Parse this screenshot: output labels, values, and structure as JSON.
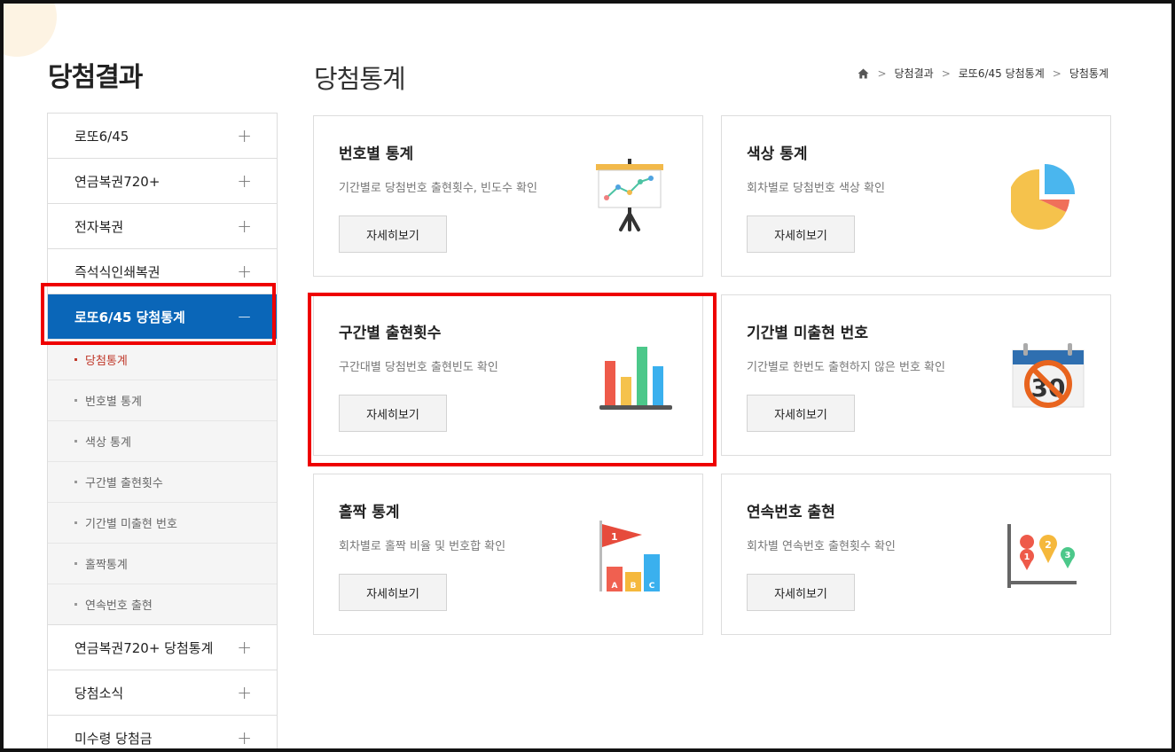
{
  "sidebar": {
    "title": "당첨결과",
    "items_top": [
      {
        "label": "로또6/45",
        "toggle": "+"
      },
      {
        "label": "연금복권720+",
        "toggle": "+"
      },
      {
        "label": "전자복권",
        "toggle": "+"
      },
      {
        "label": "즉석식인쇄복권",
        "toggle": "+"
      }
    ],
    "active": {
      "label": "로또6/45 당첨통계",
      "toggle": "−"
    },
    "sub_items": [
      {
        "label": "당첨통계"
      },
      {
        "label": "번호별 통계"
      },
      {
        "label": "색상 통계"
      },
      {
        "label": "구간별 출현횟수"
      },
      {
        "label": "기간별 미출현 번호"
      },
      {
        "label": "홀짝통계"
      },
      {
        "label": "연속번호 출현"
      }
    ],
    "items_bottom": [
      {
        "label": "연금복권720+ 당첨통계",
        "toggle": "+"
      },
      {
        "label": "당첨소식",
        "toggle": "+"
      },
      {
        "label": "미수령 당첨금",
        "toggle": "+"
      }
    ]
  },
  "main": {
    "title": "당첨통계",
    "breadcrumb": [
      "당첨결과",
      "로또6/45 당첨통계",
      "당첨통계"
    ],
    "breadcrumb_sep": ">",
    "home_icon": "home-icon",
    "cards": [
      {
        "title": "번호별 통계",
        "desc": "기간별로 당첨번호 출현횟수, 빈도수 확인",
        "button": "자세히보기",
        "icon": "presentation-chart-icon"
      },
      {
        "title": "색상 통계",
        "desc": "회차별로 당첨번호 색상 확인",
        "button": "자세히보기",
        "icon": "pie-chart-icon"
      },
      {
        "title": "구간별 출현횟수",
        "desc": "구간대별 당첨번호 출현빈도 확인",
        "button": "자세히보기",
        "icon": "bar-chart-icon"
      },
      {
        "title": "기간별 미출현 번호",
        "desc": "기간별로 한번도 출현하지 않은 번호 확인",
        "button": "자세히보기",
        "icon": "calendar-prohibited-icon",
        "icon_text": "30"
      },
      {
        "title": "홀짝 통계",
        "desc": "회차별로 홀짝 비율 및 번호합 확인",
        "button": "자세히보기",
        "icon": "flag-bar-chart-icon",
        "icon_text": [
          "1",
          "A",
          "B",
          "C"
        ]
      },
      {
        "title": "연속번호 출현",
        "desc": "회차별 연속번호 출현횟수 확인",
        "button": "자세히보기",
        "icon": "map-pin-chart-icon",
        "icon_text": [
          "1",
          "2",
          "3"
        ]
      }
    ]
  },
  "colors": {
    "active_menu": "#0a66b8",
    "highlight_box": "#e00000",
    "current_sub": "#c0392b"
  }
}
